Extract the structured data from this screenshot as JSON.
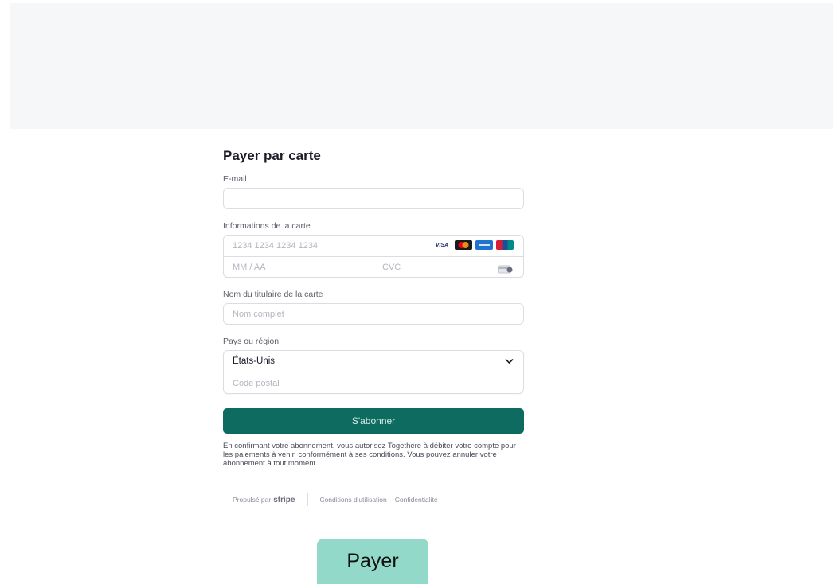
{
  "form": {
    "title": "Payer par carte",
    "email": {
      "label": "E-mail",
      "value": "",
      "placeholder": ""
    },
    "card": {
      "label": "Informations de la carte",
      "number_placeholder": "1234 1234 1234 1234",
      "expiry_placeholder": "MM / AA",
      "cvc_placeholder": "CVC",
      "brands": [
        "visa",
        "mastercard",
        "amex",
        "unionpay"
      ],
      "visa_text": "VISA"
    },
    "holder": {
      "label": "Nom du titulaire de la carte",
      "placeholder": "Nom complet"
    },
    "country": {
      "label": "Pays ou région",
      "selected": "États-Unis",
      "postal_placeholder": "Code postal"
    },
    "subscribe_label": "S'abonner",
    "terms": "En confirmant votre abonnement, vous autorisez Togethere à débiter votre compte pour les paiements à venir, conformément à ses conditions. Vous pouvez annuler votre abonnement à tout moment."
  },
  "footer": {
    "powered_by": "Propulsé par",
    "stripe": "stripe",
    "terms_link": "Conditions d'utilisation",
    "privacy_link": "Confidentialité"
  },
  "pay_button": "Payer",
  "colors": {
    "primary_button": "#0e6b5f",
    "pay_button": "#93d9c9",
    "banner": "#f6f7f9"
  }
}
